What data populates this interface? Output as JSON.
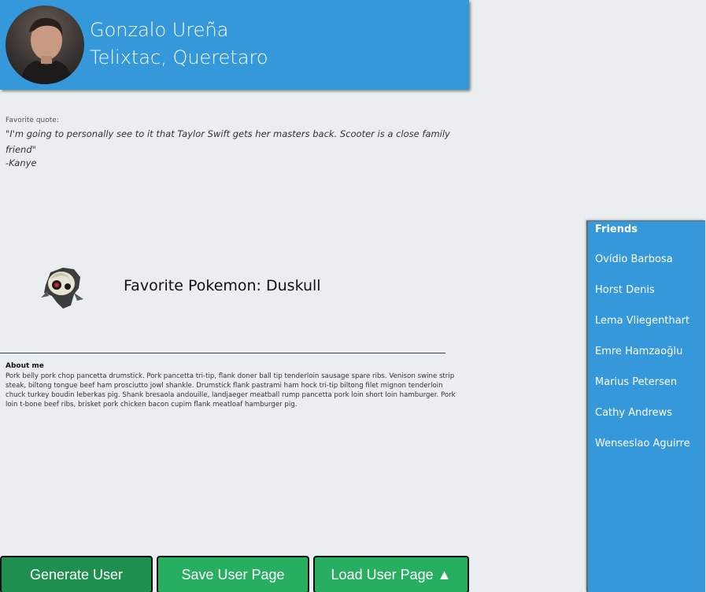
{
  "header": {
    "name": "Gonzalo Ureña",
    "location": "Telixtac, Queretaro",
    "header_color": "#3498db"
  },
  "quote": {
    "label": "Favorite quote:",
    "text": "\"I'm going to personally see to it that Taylor Swift gets her masters back. Scooter is a close family friend\"",
    "author": "-Kanye"
  },
  "pokemon": {
    "label": "Favorite Pokemon: Duskull",
    "sprite_icon": "duskull-sprite"
  },
  "about": {
    "title": "About me",
    "text": "Pork belly pork chop pancetta drumstick. Pork pancetta tri-tip, flank doner ball tip tenderloin sausage spare ribs. Venison swine strip steak, biltong tongue beef ham prosciutto jowl shankle. Drumstick flank pastrami ham hock tri-tip biltong filet mignon tenderloin chuck turkey boudin leberkas pig. Shank bresaola andouille, landjaeger meatball rump pancetta pork loin short loin hamburger. Pork loin t-bone beef ribs, brisket pork chicken bacon cupim flank meatloaf hamburger pig."
  },
  "friends": {
    "title": "Friends",
    "items": [
      "Ovídio Barbosa",
      "Horst Denis",
      "Lema Vliegenthart",
      "Emre Hamzaoğlu",
      "Marius Petersen",
      "Cathy Andrews",
      "Wenseslao Aguirre"
    ]
  },
  "buttons": {
    "generate": "Generate User",
    "save": "Save User Page",
    "load": "Load User Page ▲"
  },
  "colors": {
    "accent": "#3498db",
    "button_green": "#27ae60",
    "button_green_active": "#1e8f4e",
    "background": "#ebeef0"
  }
}
